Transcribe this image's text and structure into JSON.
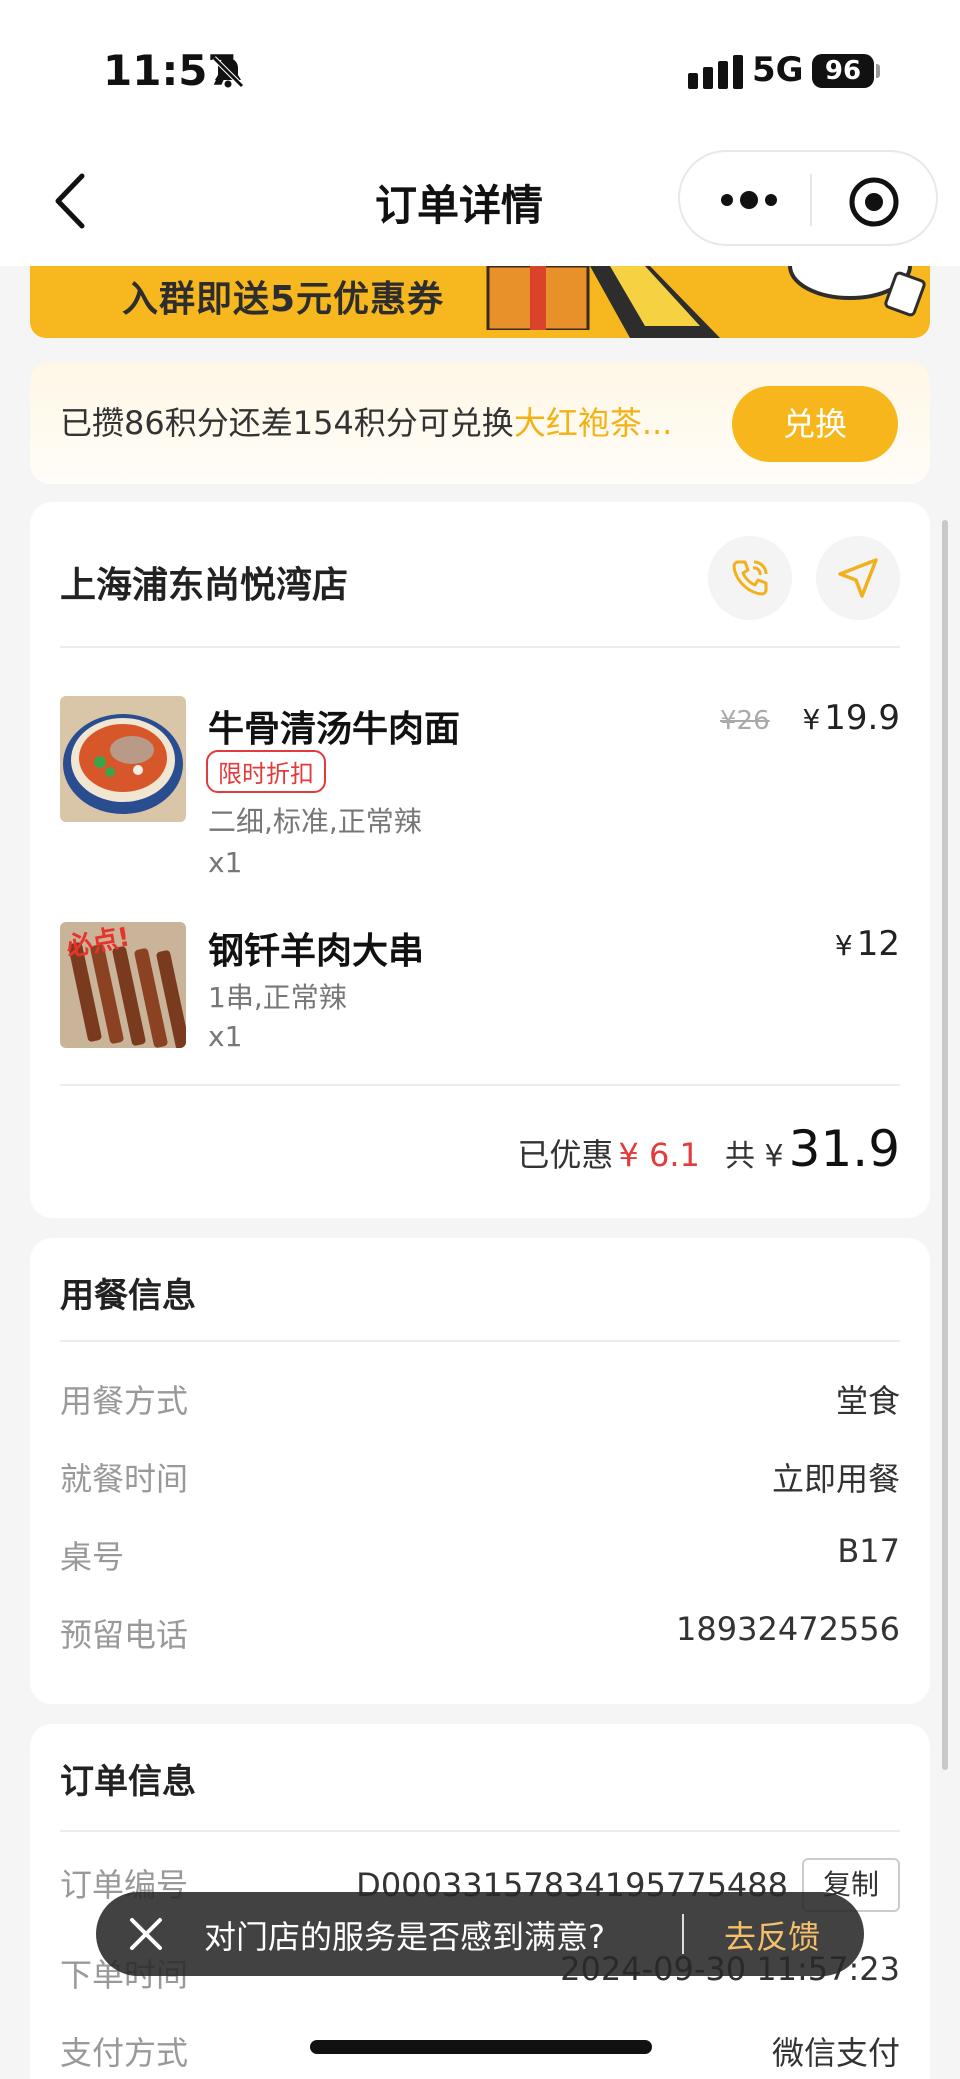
{
  "status_bar": {
    "time": "11:57",
    "network": "5G",
    "battery": "96"
  },
  "nav": {
    "title": "订单详情"
  },
  "banner": {
    "text": "入群即送5元优惠券"
  },
  "points": {
    "text_prefix": "已攒86积分还差154积分可兑换",
    "text_highlight": "大红袍茶...",
    "exchange_label": "兑换"
  },
  "store": {
    "name": "上海浦东尚悦湾店",
    "items": [
      {
        "name": "牛骨清汤牛肉面",
        "tag": "限时折扣",
        "spec": "二细,标准,正常辣",
        "qty": "x1",
        "original_price": "¥26",
        "price_symbol": "¥",
        "price": "19.9"
      },
      {
        "name": "钢钎羊肉大串",
        "img_label": "必点!",
        "spec": "1串,正常辣",
        "qty": "x1",
        "price_symbol": "¥",
        "price": "12"
      }
    ],
    "summary": {
      "discount_label": "已优惠",
      "discount_value": "¥ 6.1",
      "total_label": "共 ¥",
      "total_value": "31.9"
    }
  },
  "dining": {
    "title": "用餐信息",
    "rows": [
      {
        "label": "用餐方式",
        "value": "堂食"
      },
      {
        "label": "就餐时间",
        "value": "立即用餐"
      },
      {
        "label": "桌号",
        "value": "B17"
      },
      {
        "label": "预留电话",
        "value": "18932472556"
      }
    ]
  },
  "order": {
    "title": "订单信息",
    "rows": [
      {
        "label": "订单编号",
        "value": "D000331578341957754​88"
      },
      {
        "label": "下单时间",
        "value": "2024-09-30 11:57:23"
      },
      {
        "label": "支付方式",
        "value": "微信支付"
      }
    ],
    "copy_label": "复制"
  },
  "toast": {
    "text": "对门店的服务是否感到满意?",
    "link": "去反馈"
  },
  "colors": {
    "accent": "#f7b71c",
    "discount": "#e33a3a",
    "highlight": "#f4b114"
  }
}
